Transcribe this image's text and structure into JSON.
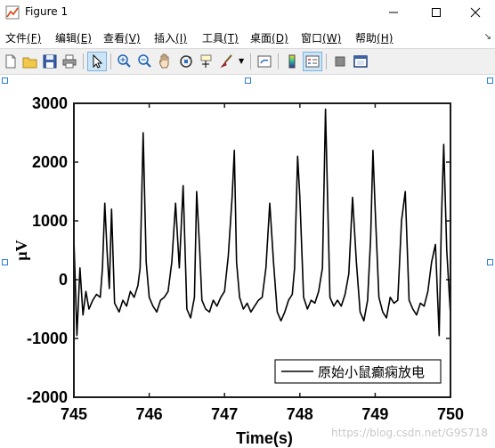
{
  "window": {
    "title": "Figure 1"
  },
  "menu": [
    {
      "label": "文件",
      "key": "(F)"
    },
    {
      "label": "编辑",
      "key": "(E)"
    },
    {
      "label": "查看",
      "key": "(V)"
    },
    {
      "label": "插入",
      "key": "(I)"
    },
    {
      "label": "工具",
      "key": "(T)"
    },
    {
      "label": "桌面",
      "key": "(D)"
    },
    {
      "label": "窗口",
      "key": "(W)"
    },
    {
      "label": "帮助",
      "key": "(H)"
    }
  ],
  "toolbar": [
    "new-figure-icon",
    "open-icon",
    "save-icon",
    "print-icon",
    "select-arrow-icon",
    "zoom-in-icon",
    "zoom-out-icon",
    "pan-icon",
    "rotate-3d-icon",
    "data-cursor-icon",
    "brush-icon",
    "link-plot-icon",
    "colorbar-icon",
    "legend-icon",
    "hide-plot-tools-icon",
    "show-plot-tools-icon"
  ],
  "chart_data": {
    "type": "line",
    "xlabel": "Time(s)",
    "ylabel": "μV",
    "xlim": [
      745,
      750
    ],
    "ylim": [
      -2000,
      3000
    ],
    "xticks": [
      "745",
      "746",
      "747",
      "748",
      "749",
      "750"
    ],
    "yticks": [
      "3000",
      "2000",
      "1000",
      "0",
      "-1000",
      "-2000"
    ],
    "legend": {
      "label": "原始小鼠癫痫放电",
      "location": "bottom-right"
    },
    "line_color": "#000000",
    "series": [
      {
        "name": "原始小鼠癫痫放电",
        "x": [
          745.0,
          745.04,
          745.08,
          745.12,
          745.16,
          745.2,
          745.25,
          745.3,
          745.35,
          745.38,
          745.41,
          745.44,
          745.47,
          745.5,
          745.54,
          745.6,
          745.65,
          745.7,
          745.75,
          745.8,
          745.85,
          745.88,
          745.92,
          745.96,
          746.0,
          746.05,
          746.1,
          746.15,
          746.2,
          746.25,
          746.3,
          746.35,
          746.4,
          746.45,
          746.5,
          746.55,
          746.6,
          746.63,
          746.67,
          746.7,
          746.75,
          746.8,
          746.85,
          746.9,
          746.95,
          747.0,
          747.05,
          747.1,
          747.13,
          747.16,
          747.2,
          747.25,
          747.3,
          747.35,
          747.4,
          747.45,
          747.5,
          747.55,
          747.6,
          747.65,
          747.7,
          747.75,
          747.8,
          747.85,
          747.9,
          747.93,
          747.97,
          748.0,
          748.05,
          748.1,
          748.15,
          748.2,
          748.25,
          748.3,
          748.34,
          748.37,
          748.4,
          748.45,
          748.5,
          748.55,
          748.6,
          748.65,
          748.7,
          748.75,
          748.8,
          748.85,
          748.9,
          748.94,
          748.97,
          749.0,
          749.05,
          749.1,
          749.15,
          749.2,
          749.25,
          749.3,
          749.35,
          749.4,
          749.45,
          749.5,
          749.55,
          749.6,
          749.65,
          749.7,
          749.75,
          749.8,
          749.85,
          749.88,
          749.91,
          749.95,
          750.0
        ],
        "y": [
          700,
          -950,
          200,
          -600,
          -200,
          -500,
          -350,
          -250,
          -300,
          200,
          1300,
          500,
          -150,
          1200,
          -400,
          -550,
          -350,
          -450,
          -200,
          -300,
          -100,
          200,
          2500,
          300,
          -300,
          -450,
          -550,
          -350,
          -300,
          -200,
          300,
          1300,
          200,
          1600,
          -500,
          -650,
          -300,
          1500,
          500,
          -350,
          -500,
          -550,
          -350,
          -450,
          -300,
          -200,
          400,
          1400,
          2200,
          300,
          -300,
          -500,
          -400,
          -550,
          -450,
          -350,
          -300,
          200,
          1300,
          300,
          -550,
          -700,
          -550,
          -350,
          -250,
          200,
          2100,
          1400,
          -300,
          -500,
          -350,
          -400,
          -200,
          200,
          2900,
          1300,
          -300,
          -450,
          -350,
          -450,
          -250,
          100,
          1400,
          300,
          -550,
          -700,
          -350,
          700,
          2200,
          1200,
          -300,
          -550,
          -650,
          -300,
          -400,
          -350,
          1000,
          1500,
          -350,
          -500,
          -600,
          -400,
          -450,
          -200,
          300,
          600,
          -950,
          1000,
          2300,
          500,
          -600
        ]
      }
    ]
  }
}
